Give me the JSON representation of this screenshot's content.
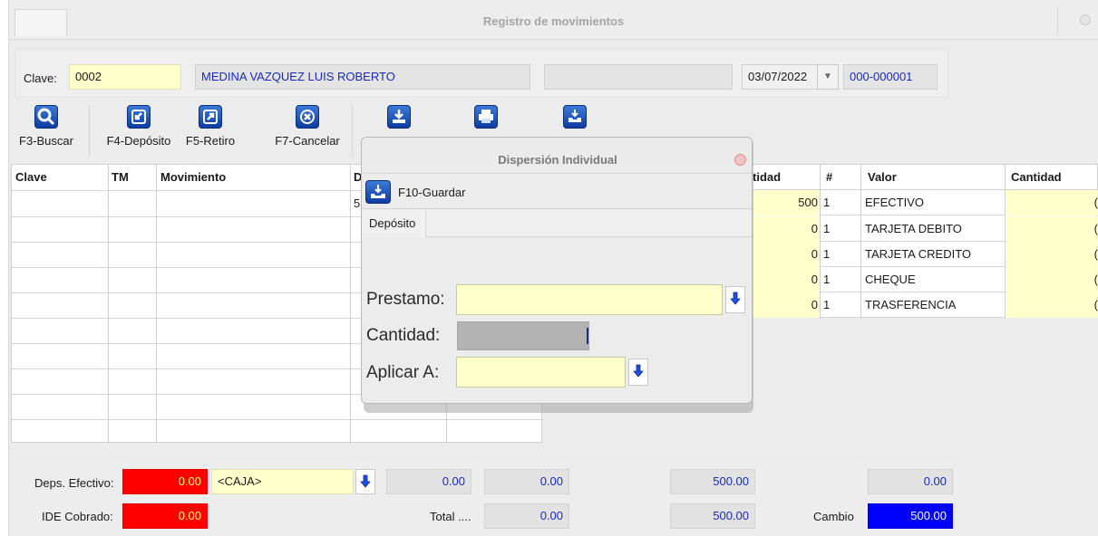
{
  "window": {
    "title": "Registro de movimientos"
  },
  "header": {
    "clave_label": "Clave:",
    "clave_value": "0002",
    "nombre": "MEDINA VAZQUEZ LUIS ROBERTO",
    "extra": "",
    "fecha": "03/07/2022",
    "folio": "000-000001"
  },
  "toolbar": [
    {
      "label": "F3-Buscar",
      "icon": "search-icon"
    },
    {
      "label": "F4-Depósito",
      "icon": "deposit-arrow-icon"
    },
    {
      "label": "F5-Retiro",
      "icon": "withdraw-arrow-icon"
    },
    {
      "label": "F7-Cancelar",
      "icon": "cancel-x-icon"
    }
  ],
  "grid": {
    "headers": [
      "Clave",
      "TM",
      "Movimiento",
      "D"
    ],
    "first_row_partial": "5"
  },
  "payments": {
    "headers": [
      "tidad",
      "#",
      "Valor",
      "Cantidad"
    ],
    "rows": [
      {
        "amount": "500",
        "num": "1",
        "valor": "EFECTIVO",
        "cant": "("
      },
      {
        "amount": "0",
        "num": "1",
        "valor": "TARJETA DEBITO",
        "cant": "("
      },
      {
        "amount": "0",
        "num": "1",
        "valor": "TARJETA CREDITO",
        "cant": "("
      },
      {
        "amount": "0",
        "num": "1",
        "valor": "CHEQUE",
        "cant": "("
      },
      {
        "amount": "0",
        "num": "1",
        "valor": "TRASFERENCIA",
        "cant": "("
      }
    ]
  },
  "footer": {
    "deps_label": "Deps. Efectivo:",
    "deps_value": "0.00",
    "caja": "<CAJA>",
    "v1": "0.00",
    "v2": "0.00",
    "v3": "500.00",
    "v4": "0.00",
    "ide_label": "IDE Cobrado:",
    "ide_value": "0.00",
    "total_label": "Total ....",
    "total_value": "0.00",
    "v5": "500.00",
    "cambio_label": "Cambio",
    "cambio_value": "500.00"
  },
  "dialog": {
    "title": "Dispersión Individual",
    "save_label": "F10-Guardar",
    "tab": "Depósito",
    "prestamo_label": "Prestamo:",
    "cantidad_label": "Cantidad:",
    "aplicar_label": "Aplicar A:"
  },
  "colors": {
    "yellow_field": "#ffffcc",
    "red_field": "#ff0000",
    "blue_field": "#0000ff",
    "link_text": "#1a2bb8"
  }
}
